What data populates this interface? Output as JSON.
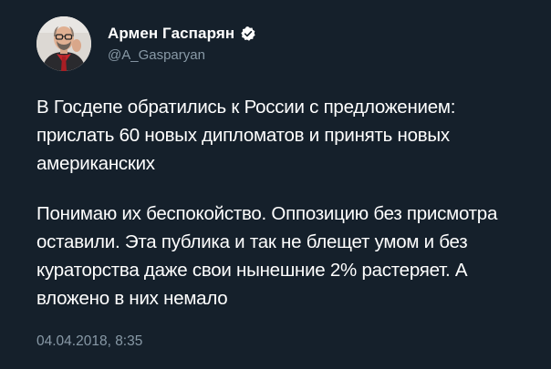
{
  "author": {
    "display_name": "Армен Гаспарян",
    "handle": "@A_Gasparyan",
    "verified": true,
    "avatar_icon": "person-photo-avatar"
  },
  "tweet": {
    "paragraphs": [
      "В Госдепе обратились к России с предложением: прислать 60 новых дипломатов и принять новых американских",
      "Понимаю их беспокойство. Оппозицию без присмотра оставили. Эта публика и так не блещет умом и без кураторства даже свои нынешние 2% растеряет. А вложено в них немало"
    ],
    "timestamp": "04.04.2018, 8:35"
  },
  "theme": {
    "background": "#15202b",
    "text": "#ffffff",
    "secondary_text": "#8899a6",
    "verified_badge": "#ffffff"
  }
}
